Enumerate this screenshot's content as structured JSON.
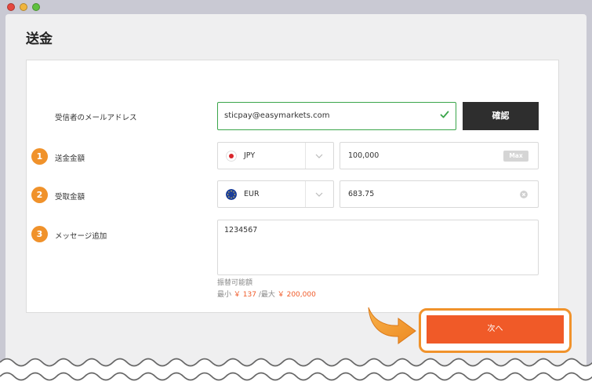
{
  "page": {
    "title": "送金"
  },
  "form": {
    "email": {
      "label": "受信者のメールアドレス",
      "value": "sticpay@easymarkets.com"
    },
    "confirm_button": "確認",
    "send_amount": {
      "step": "1",
      "label": "送金金額",
      "currency": "JPY",
      "value": "100,000",
      "max_label": "Max"
    },
    "receive_amount": {
      "step": "2",
      "label": "受取金額",
      "currency": "EUR",
      "value": "683.75"
    },
    "message": {
      "step": "3",
      "label": "メッセージ追加",
      "value": "1234567"
    },
    "available": {
      "title": "振替可能額",
      "min_label": "最小",
      "min_value": "￥ 137",
      "separator": "/最大",
      "max_value": "￥ 200,000"
    }
  },
  "next_button": "次へ",
  "colors": {
    "accent": "#f05a28",
    "step_badge": "#f0922b",
    "valid_border": "#3aa54a",
    "confirm_bg": "#2e2e2e"
  },
  "icons": [
    "check-icon",
    "japan-flag-icon",
    "eu-flag-icon",
    "chevron-down-icon",
    "clear-icon",
    "pointer-arrow-icon"
  ]
}
